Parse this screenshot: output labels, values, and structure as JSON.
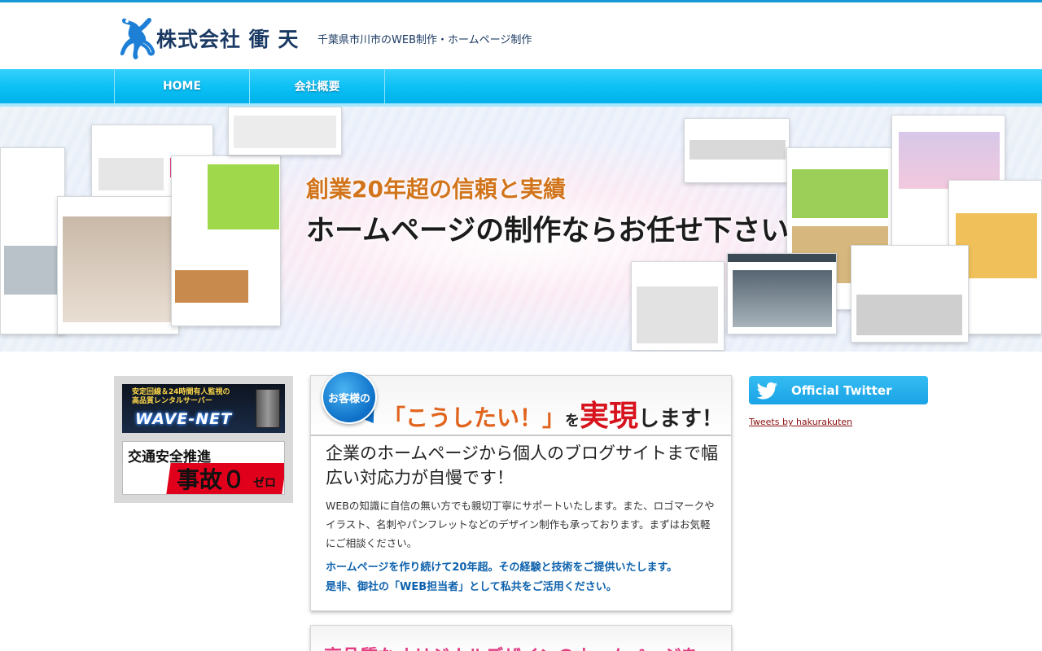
{
  "header": {
    "brand": "株式会社 衝 天",
    "tagline": "千葉県市川市のWEB制作・ホームページ制作"
  },
  "nav": {
    "items": [
      {
        "label": "HOME"
      },
      {
        "label": "会社概要"
      }
    ]
  },
  "hero": {
    "line1": "創業20年超の信頼と実績",
    "line2": "ホームページの制作ならお任せ下さい"
  },
  "left_banners": {
    "wave_top": "安定回線＆24時間有人監視の",
    "wave_sub": "高品質レンタルサーバー",
    "wave_name": "WAVE-NET",
    "zero_top": "交通安全推進",
    "zero_main": "事故０",
    "zero_sub": "ゼロ"
  },
  "card": {
    "badge": "お客様の",
    "title_a": "「こうしたい！」",
    "title_b": "を",
    "title_c": "実現",
    "title_d": "します！",
    "lead": "企業のホームページから個人のブログサイトまで幅広い対応力が自慢です！",
    "body": "WEBの知識に自信の無い方でも親切丁寧にサポートいたします。また、ロゴマークやイラスト、名刺やパンフレットなどのデザイン制作も承っております。まずはお気軽にご相談ください。",
    "em1": "ホームページを作り続けて20年超。その経験と技術をご提供いたします。",
    "em2": "是非、御社の「WEB担当者」として私共をご活用ください。"
  },
  "card2": {
    "title": "高品質なオリジナルデザインのホームページを"
  },
  "twitter": {
    "label": "Official Twitter",
    "link": "Tweets by hakurakuten"
  },
  "colors": {
    "nav_blue": "#0ac0f4",
    "brand_navy": "#1b3a63",
    "accent_red": "#d7131d",
    "accent_orange": "#e0641d"
  }
}
